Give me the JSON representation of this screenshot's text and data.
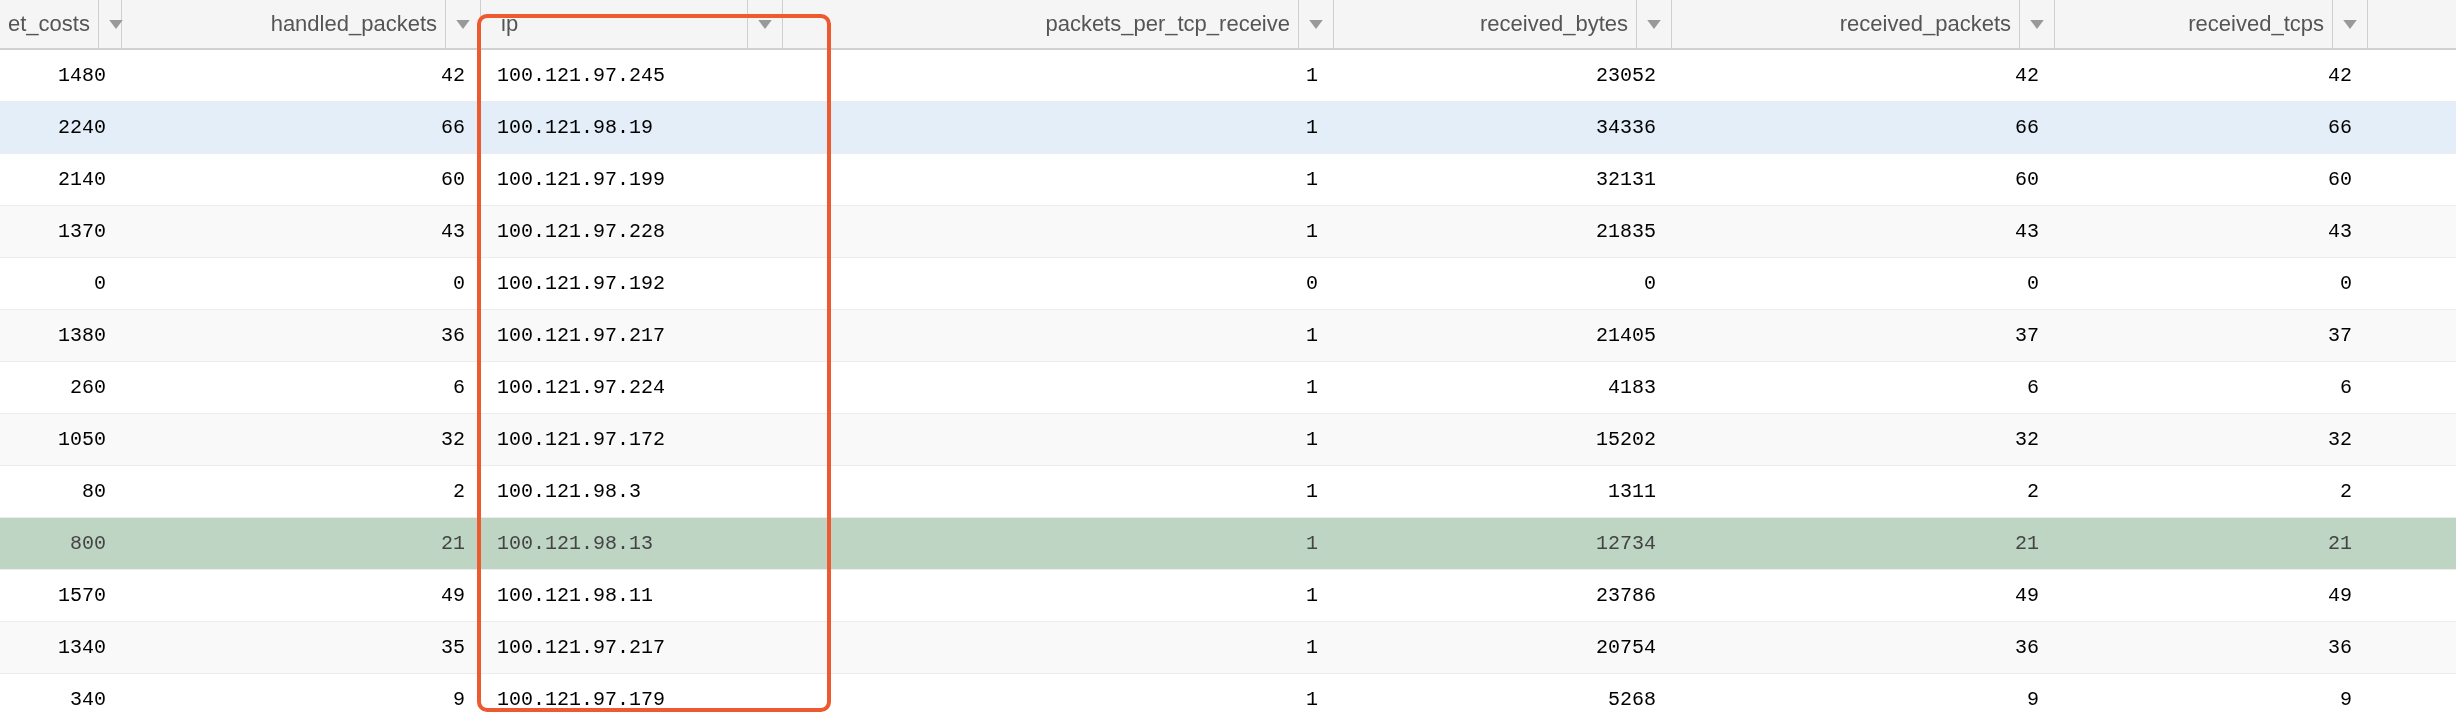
{
  "table": {
    "columns": [
      {
        "label": "et_costs",
        "highlighted": false
      },
      {
        "label": "handled_packets",
        "highlighted": false
      },
      {
        "label": "ip",
        "highlighted": true
      },
      {
        "label": "packets_per_tcp_receive",
        "highlighted": false
      },
      {
        "label": "received_bytes",
        "highlighted": false
      },
      {
        "label": "received_packets",
        "highlighted": false
      },
      {
        "label": "received_tcps",
        "highlighted": false
      }
    ],
    "rows": [
      {
        "selected": false,
        "marked": false,
        "cells": [
          "1480",
          "42",
          "100.121.97.245",
          "1",
          "23052",
          "42",
          "42"
        ]
      },
      {
        "selected": true,
        "marked": false,
        "cells": [
          "2240",
          "66",
          "100.121.98.19",
          "1",
          "34336",
          "66",
          "66"
        ]
      },
      {
        "selected": false,
        "marked": false,
        "cells": [
          "2140",
          "60",
          "100.121.97.199",
          "1",
          "32131",
          "60",
          "60"
        ]
      },
      {
        "selected": false,
        "marked": false,
        "cells": [
          "1370",
          "43",
          "100.121.97.228",
          "1",
          "21835",
          "43",
          "43"
        ]
      },
      {
        "selected": false,
        "marked": false,
        "cells": [
          "0",
          "0",
          "100.121.97.192",
          "0",
          "0",
          "0",
          "0"
        ]
      },
      {
        "selected": false,
        "marked": false,
        "cells": [
          "1380",
          "36",
          "100.121.97.217",
          "1",
          "21405",
          "37",
          "37"
        ]
      },
      {
        "selected": false,
        "marked": false,
        "cells": [
          "260",
          "6",
          "100.121.97.224",
          "1",
          "4183",
          "6",
          "6"
        ]
      },
      {
        "selected": false,
        "marked": false,
        "cells": [
          "1050",
          "32",
          "100.121.97.172",
          "1",
          "15202",
          "32",
          "32"
        ]
      },
      {
        "selected": false,
        "marked": false,
        "cells": [
          "80",
          "2",
          "100.121.98.3",
          "1",
          "1311",
          "2",
          "2"
        ]
      },
      {
        "selected": false,
        "marked": true,
        "cells": [
          "800",
          "21",
          "100.121.98.13",
          "1",
          "12734",
          "21",
          "21"
        ]
      },
      {
        "selected": false,
        "marked": false,
        "cells": [
          "1570",
          "49",
          "100.121.98.11",
          "1",
          "23786",
          "49",
          "49"
        ]
      },
      {
        "selected": false,
        "marked": false,
        "cells": [
          "1340",
          "35",
          "100.121.97.217",
          "1",
          "20754",
          "36",
          "36"
        ]
      },
      {
        "selected": false,
        "marked": false,
        "cells": [
          "340",
          "9",
          "100.121.97.179",
          "1",
          "5268",
          "9",
          "9"
        ]
      }
    ]
  }
}
